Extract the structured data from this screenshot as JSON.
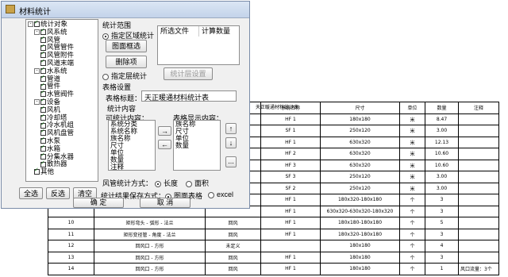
{
  "background_table": {
    "title": "天正暖通材料统计表",
    "header": [
      "",
      "",
      "",
      "系统名称",
      "尺寸",
      "单位",
      "数量",
      "注释"
    ],
    "rows": [
      {
        "no": "",
        "name": "",
        "type": "",
        "system": "HF 1",
        "size": "180x180",
        "unit": "米",
        "qty": "8.47",
        "note": ""
      },
      {
        "no": "",
        "name": "",
        "type": "",
        "system": "SF 1",
        "size": "250x120",
        "unit": "米",
        "qty": "3.00",
        "note": ""
      },
      {
        "no": "",
        "name": "",
        "type": "",
        "system": "HF 1",
        "size": "630x320",
        "unit": "米",
        "qty": "12.13",
        "note": ""
      },
      {
        "no": "",
        "name": "",
        "type": "",
        "system": "HF 2",
        "size": "630x320",
        "unit": "米",
        "qty": "10.60",
        "note": ""
      },
      {
        "no": "",
        "name": "",
        "type": "",
        "system": "HF 3",
        "size": "630x320",
        "unit": "米",
        "qty": "10.60",
        "note": ""
      },
      {
        "no": "",
        "name": "",
        "type": "",
        "system": "SF 3",
        "size": "250x120",
        "unit": "米",
        "qty": "3.00",
        "note": ""
      },
      {
        "no": "",
        "name": "",
        "type": "",
        "system": "SF 2",
        "size": "250x120",
        "unit": "米",
        "qty": "3.00",
        "note": ""
      },
      {
        "no": "",
        "name": "",
        "type": "",
        "system": "HF 1",
        "size": "180x320-180x180",
        "unit": "个",
        "qty": "3",
        "note": ""
      },
      {
        "no": "",
        "name": "",
        "type": "",
        "system": "HF 1",
        "size": "630x320-630x320-180x320",
        "unit": "个",
        "qty": "3",
        "note": ""
      },
      {
        "no": "10",
        "name": "矩形弯头 - 弧形 - 法兰",
        "type": "回风",
        "system": "HF 1",
        "size": "180x180-180x180",
        "unit": "个",
        "qty": "5",
        "note": ""
      },
      {
        "no": "11",
        "name": "矩形变径管 - 角度 - 法兰",
        "type": "回风",
        "system": "HF 1",
        "size": "180x320-180x180",
        "unit": "个",
        "qty": "3",
        "note": ""
      },
      {
        "no": "12",
        "name": "回风口 - 方形",
        "type": "未定义",
        "system": "",
        "size": "180x180",
        "unit": "个",
        "qty": "4",
        "note": ""
      },
      {
        "no": "13",
        "name": "回风口 - 方形",
        "type": "回风",
        "system": "HF 1",
        "size": "180x180",
        "unit": "个",
        "qty": "3",
        "note": ""
      },
      {
        "no": "14",
        "name": "回风口 - 方形",
        "type": "回风",
        "system": "HF 1",
        "size": "180x180",
        "unit": "个",
        "qty": "1",
        "note": "风口流量：3个"
      }
    ]
  },
  "dialog": {
    "title": "材料统计",
    "tree": [
      {
        "label": "统计对象",
        "level": 0,
        "expander": "-"
      },
      {
        "label": "风系统",
        "level": 1,
        "expander": "-"
      },
      {
        "label": "风管",
        "level": 2,
        "expander": ""
      },
      {
        "label": "风管管件",
        "level": 2,
        "expander": ""
      },
      {
        "label": "风管附件",
        "level": 2,
        "expander": ""
      },
      {
        "label": "风道末端",
        "level": 2,
        "expander": ""
      },
      {
        "label": "水系统",
        "level": 1,
        "expander": "-"
      },
      {
        "label": "管道",
        "level": 2,
        "expander": ""
      },
      {
        "label": "管件",
        "level": 2,
        "expander": ""
      },
      {
        "label": "水管阀件",
        "level": 2,
        "expander": ""
      },
      {
        "label": "设备",
        "level": 1,
        "expander": "-"
      },
      {
        "label": "风机",
        "level": 2,
        "expander": ""
      },
      {
        "label": "冷却塔",
        "level": 2,
        "expander": ""
      },
      {
        "label": "冷水机组",
        "level": 2,
        "expander": ""
      },
      {
        "label": "风机盘管",
        "level": 2,
        "expander": ""
      },
      {
        "label": "水泵",
        "level": 2,
        "expander": ""
      },
      {
        "label": "水箱",
        "level": 2,
        "expander": ""
      },
      {
        "label": "分集水器",
        "level": 2,
        "expander": ""
      },
      {
        "label": "散热器",
        "level": 2,
        "expander": ""
      },
      {
        "label": "其他",
        "level": 1,
        "expander": ""
      }
    ],
    "scope_label": "统计范围",
    "radio_region": "指定区域统计",
    "btn_select_region": "图面框选",
    "btn_delete_item": "删除项",
    "file_col_header": "所选文件",
    "count_col_header": "计算数量",
    "radio_floor": "指定层统计",
    "btn_floor_settings": "统计层设置",
    "table_settings_label": "表格设置",
    "table_title_label": "表格标题：",
    "table_title_value": "天正暖通材料统计表",
    "stat_content_label": "统计内容",
    "available_label": "可统计内容：",
    "available_items": [
      "系统分类",
      "系统名称",
      "族名称",
      "尺寸",
      "单位",
      "数量",
      "注释"
    ],
    "display_label": "表格显示内容：",
    "display_items": [
      "族名称",
      "尺寸",
      "单位",
      "数量"
    ],
    "btn_add_arrow": "→",
    "btn_remove_arrow": "←",
    "btn_up_arrow": "↑",
    "btn_down_arrow": "↓",
    "btn_more": "...",
    "duct_method_label": "风管统计方式：",
    "radio_length": "长度",
    "radio_area": "面积",
    "save_method_label": "统计结果保存方式：",
    "radio_drawing_table": "图面表格",
    "radio_excel": "excel",
    "btn_select_all": "全选",
    "btn_invert": "反选",
    "btn_clear": "清空",
    "btn_ok": "确  定",
    "btn_cancel": "取  消"
  }
}
